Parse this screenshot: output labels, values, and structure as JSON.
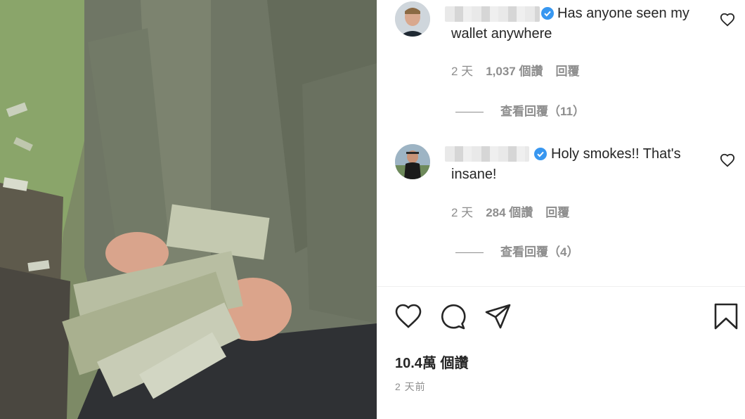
{
  "post": {
    "comments": [
      {
        "text": "Has anyone seen my wallet anywhere",
        "age": "2 天",
        "likes": "1,037 個讚",
        "reply_label": "回覆",
        "view_replies": "查看回覆（11）"
      },
      {
        "text": "Holy smokes!! That's insane!",
        "age": "2 天",
        "likes": "284 個讚",
        "reply_label": "回覆",
        "view_replies": "查看回覆（4）"
      }
    ],
    "actions": [
      "heart-icon",
      "comment-icon",
      "share-icon",
      "bookmark-icon"
    ],
    "likes_total": "10.4萬 個讚",
    "posted": "2 天前"
  },
  "colors": {
    "verified_blue": "#3897f0",
    "text": "#262626",
    "muted": "#8e8e8e"
  }
}
